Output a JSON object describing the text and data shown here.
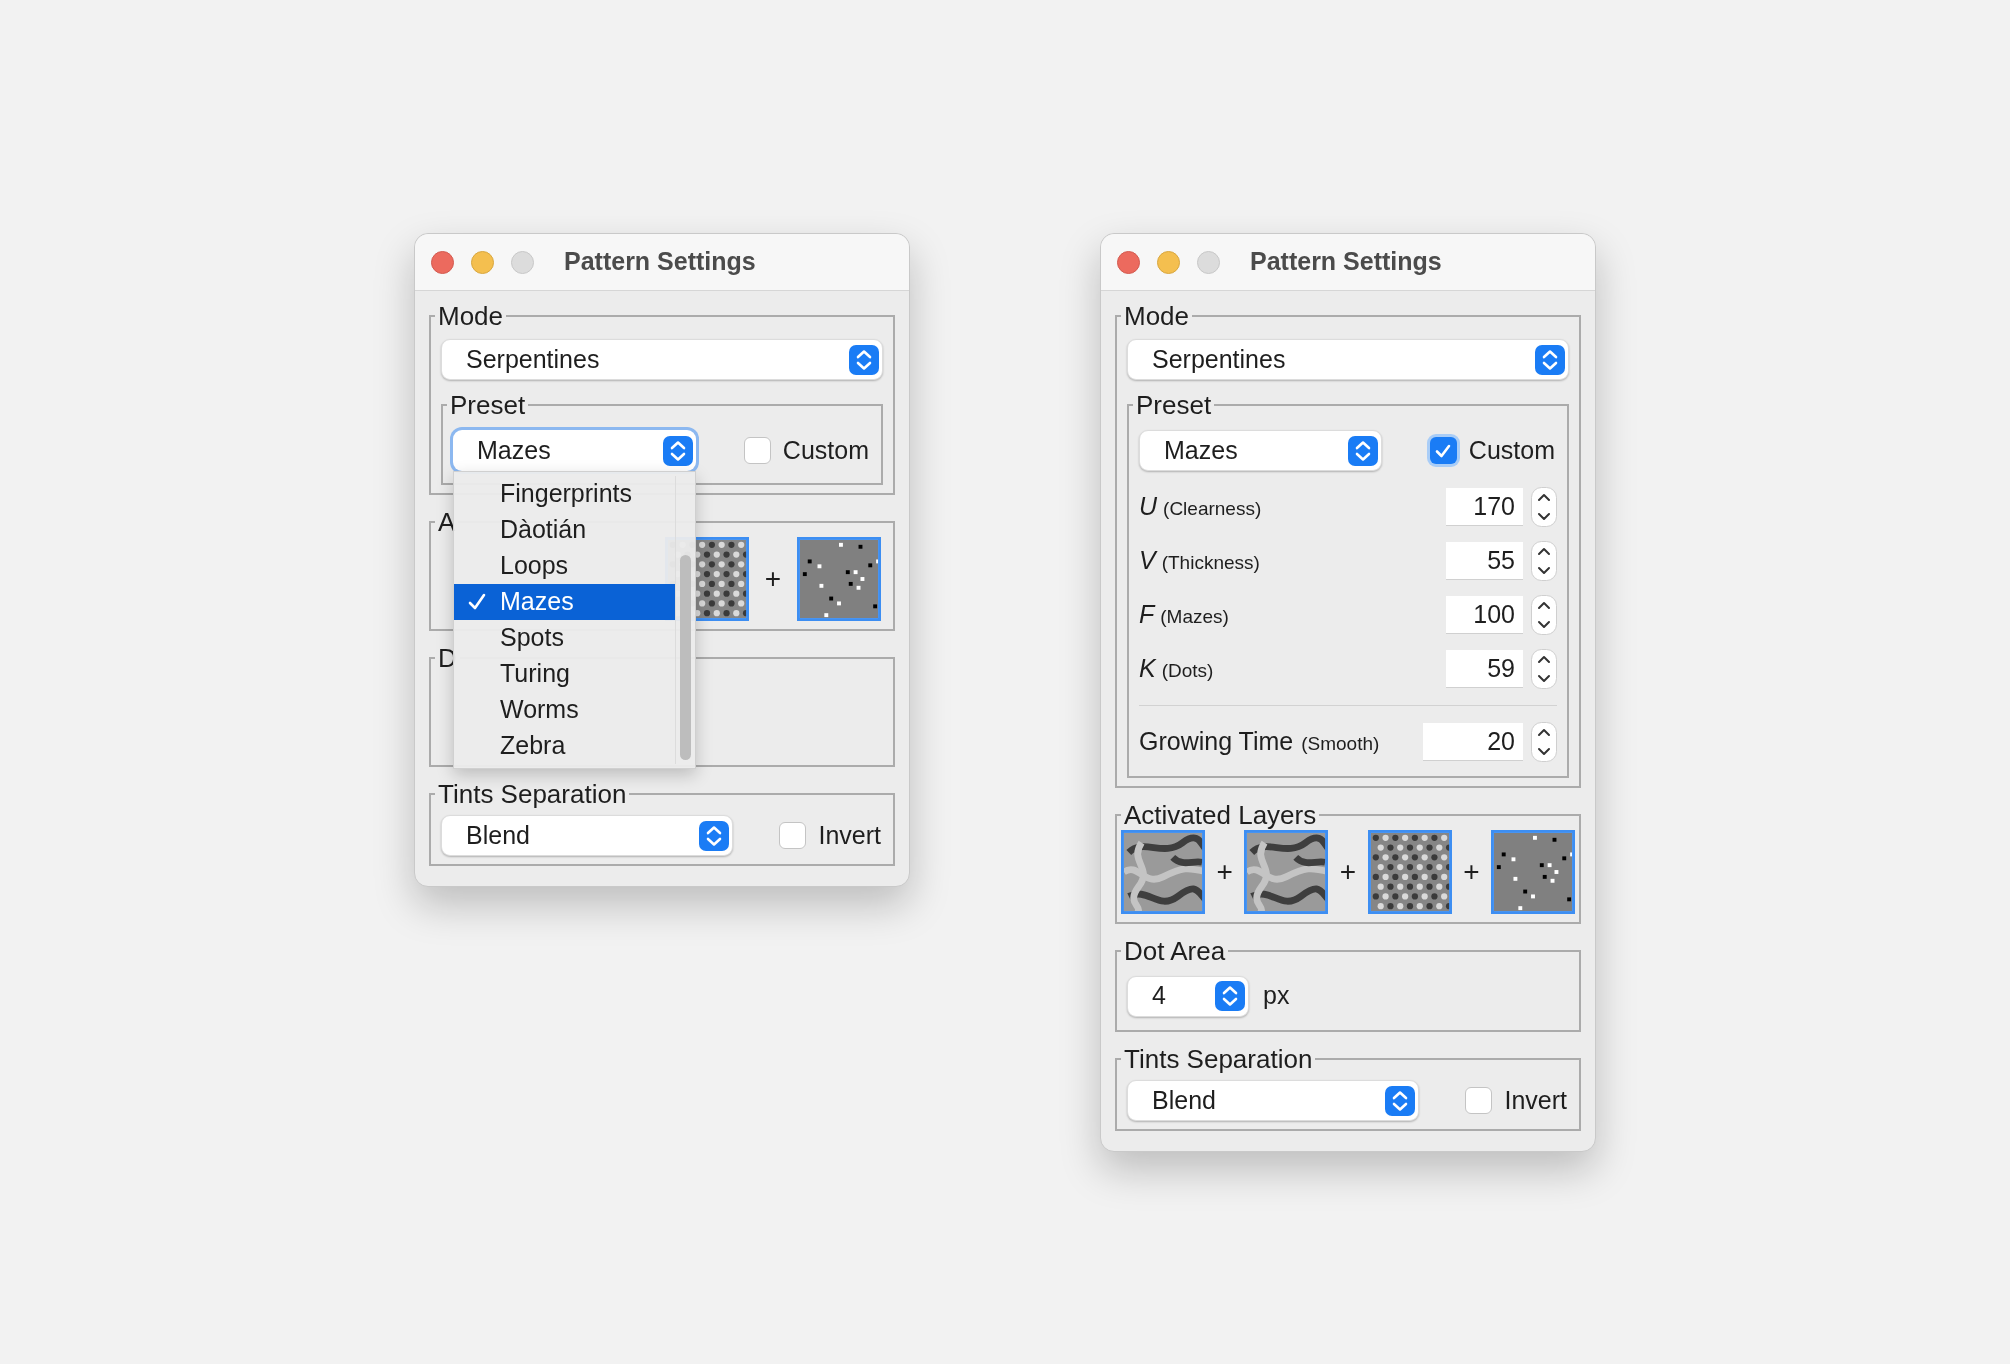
{
  "windows": [
    {
      "title": "Pattern Settings",
      "mode": {
        "legend": "Mode",
        "value": "Serpentines"
      },
      "preset": {
        "legend": "Preset",
        "value": "Mazes",
        "focused": true,
        "custom": {
          "label": "Custom",
          "checked": false
        },
        "menu": [
          {
            "label": "Fingerprints",
            "selected": false
          },
          {
            "label": "Dàotián",
            "selected": false
          },
          {
            "label": "Loops",
            "selected": false
          },
          {
            "label": "Mazes",
            "selected": true
          },
          {
            "label": "Spots",
            "selected": false
          },
          {
            "label": "Turing",
            "selected": false
          },
          {
            "label": "Worms",
            "selected": false
          },
          {
            "label": "Zebra",
            "selected": false
          }
        ]
      },
      "layers": {
        "legend": "A",
        "items": [
          {
            "kind": "spots"
          },
          {
            "kind": "plus",
            "text": "+"
          },
          {
            "kind": "dots"
          }
        ]
      },
      "dot_area": {
        "legend": "D"
      },
      "tints": {
        "legend": "Tints Separation",
        "value": "Blend",
        "invert": {
          "label": "Invert",
          "checked": false
        }
      }
    },
    {
      "title": "Pattern Settings",
      "mode": {
        "legend": "Mode",
        "value": "Serpentines"
      },
      "preset": {
        "legend": "Preset",
        "value": "Mazes",
        "focused": false,
        "custom": {
          "label": "Custom",
          "checked": true
        },
        "params": [
          {
            "symbol": "U",
            "name": "(Clearness)",
            "value": "170"
          },
          {
            "symbol": "V",
            "name": "(Thickness)",
            "value": "55"
          },
          {
            "symbol": "F",
            "name": "(Mazes)",
            "value": "100"
          },
          {
            "symbol": "K",
            "name": "(Dots)",
            "value": "59"
          }
        ],
        "growing": {
          "label": "Growing Time",
          "note": "(Smooth)",
          "value": "20"
        }
      },
      "layers": {
        "legend": "Activated Layers",
        "items": [
          {
            "kind": "stripes"
          },
          {
            "kind": "plus",
            "text": "+"
          },
          {
            "kind": "stripes"
          },
          {
            "kind": "plus",
            "text": "+"
          },
          {
            "kind": "spots"
          },
          {
            "kind": "plus",
            "text": "+"
          },
          {
            "kind": "dots"
          }
        ]
      },
      "dot_area": {
        "legend": "Dot Area",
        "value": "4",
        "unit": "px"
      },
      "tints": {
        "legend": "Tints Separation",
        "value": "Blend",
        "invert": {
          "label": "Invert",
          "checked": false
        }
      }
    }
  ]
}
